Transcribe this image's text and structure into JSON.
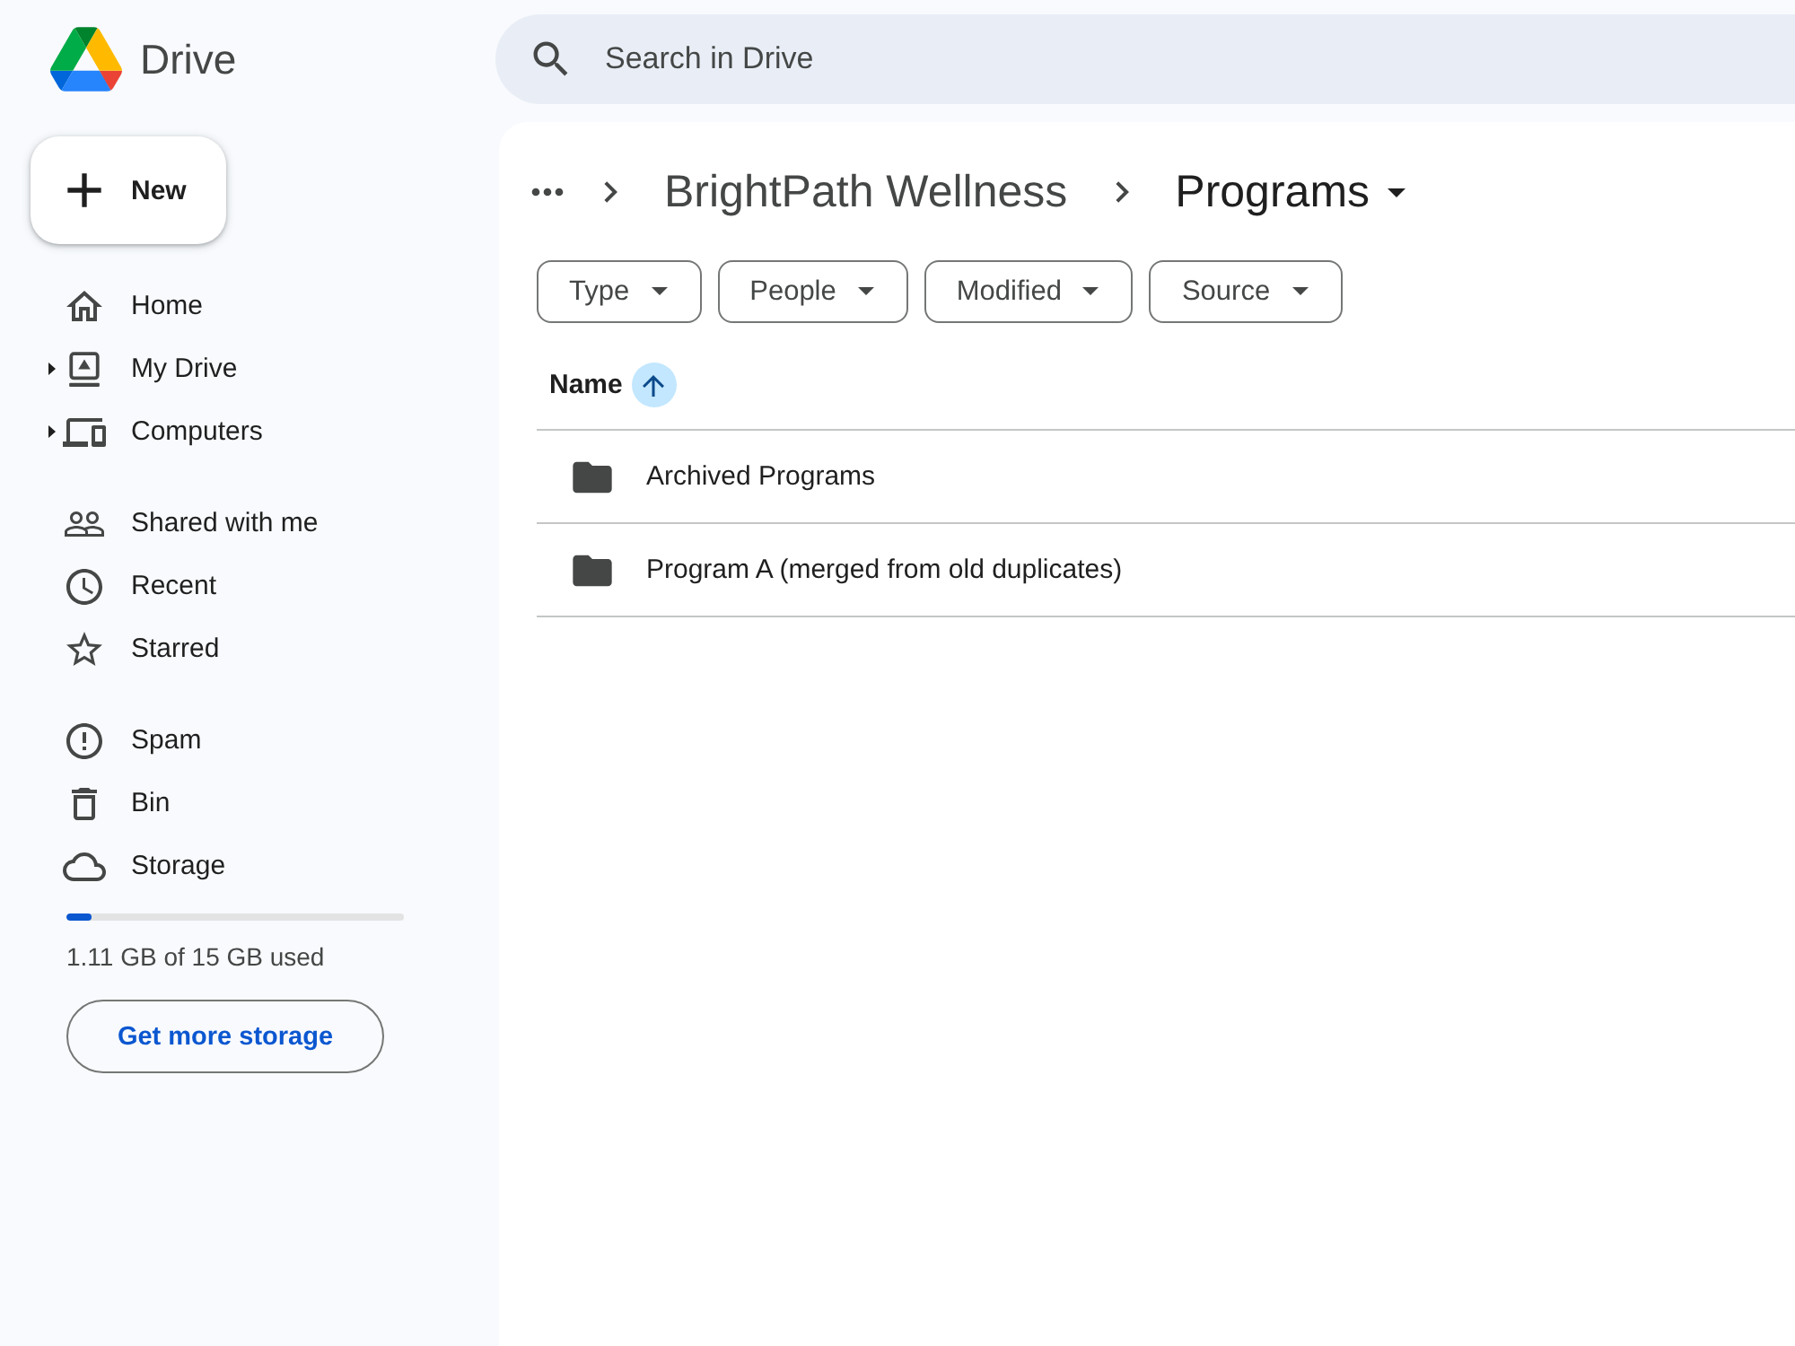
{
  "app": {
    "name": "Drive"
  },
  "search": {
    "placeholder": "Search in Drive"
  },
  "new_button": {
    "label": "New"
  },
  "sidebar": {
    "sections": [
      {
        "items": [
          {
            "label": "Home",
            "expandable": false,
            "selected": false
          },
          {
            "label": "My Drive",
            "expandable": true,
            "selected": false
          },
          {
            "label": "Computers",
            "expandable": true,
            "selected": false
          }
        ]
      },
      {
        "items": [
          {
            "label": "Shared with me",
            "expandable": false,
            "selected": false
          },
          {
            "label": "Recent",
            "expandable": false,
            "selected": false
          },
          {
            "label": "Starred",
            "expandable": false,
            "selected": false
          }
        ]
      },
      {
        "items": [
          {
            "label": "Spam",
            "expandable": false,
            "selected": false
          },
          {
            "label": "Bin",
            "expandable": false,
            "selected": false
          },
          {
            "label": "Storage",
            "expandable": false,
            "selected": false
          }
        ]
      }
    ]
  },
  "storage": {
    "level": 0.074,
    "usage": "1.11 GB of 15 GB used",
    "button": "Get more storage"
  },
  "breadcrumb": {
    "items": [
      "BrightPath Wellness",
      "Programs"
    ]
  },
  "filters": [
    "Type",
    "People",
    "Modified",
    "Source"
  ],
  "table": {
    "columns": [
      {
        "label": "Name",
        "sorted": true,
        "ascending": true
      }
    ],
    "rows": [
      {
        "name": "Archived Programs",
        "selected": false
      },
      {
        "name": "Program A (merged from old duplicates)",
        "selected": false
      }
    ]
  }
}
